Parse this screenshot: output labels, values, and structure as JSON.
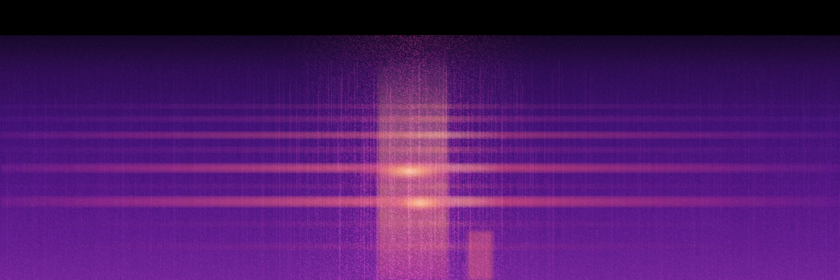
{
  "image": {
    "kind": "spectrogram",
    "colormap": "magma",
    "colors": {
      "background": "#000000",
      "low": "#1a0a3a",
      "mid_low": "#3b0f6f",
      "mid": "#6a1b8a",
      "mid_high": "#b5367a",
      "high": "#f07a5f",
      "peak": "#fde3b0"
    }
  }
}
